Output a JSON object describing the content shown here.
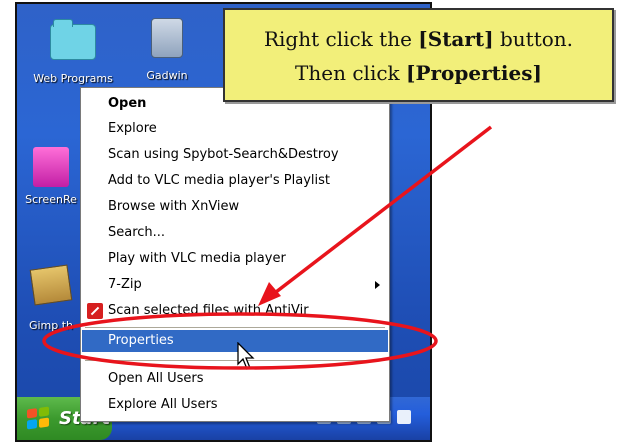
{
  "desktop": {
    "icons": [
      {
        "label": "Web Programs",
        "icon": "folder-icon"
      },
      {
        "label": "Gadwin",
        "icon": "camera-icon"
      },
      {
        "label": "ScreenRe",
        "icon": "pink-folder-icon"
      },
      {
        "label": "Gimp th",
        "icon": "package-icon"
      }
    ]
  },
  "callout": {
    "line1_prefix": "Right click the ",
    "line1_bold": "[Start]",
    "line1_suffix": " button.",
    "line2_prefix": "Then click ",
    "line2_bold": "[Properties]"
  },
  "context_menu": {
    "items": [
      {
        "label": "Open",
        "bold": true
      },
      {
        "label": "Explore"
      },
      {
        "label": "Scan using Spybot-Search&Destroy"
      },
      {
        "label": "Add to VLC media player's Playlist"
      },
      {
        "label": "Browse with XnView"
      },
      {
        "label": "Search..."
      },
      {
        "label": "Play with VLC media player"
      },
      {
        "label": "7-Zip",
        "submenu": true
      },
      {
        "label": "Scan selected files with AntiVir",
        "icon": "antivir-icon"
      },
      {
        "label": "Properties",
        "selected": true
      },
      {
        "label": "Open All Users"
      },
      {
        "label": "Explore All Users"
      }
    ]
  },
  "taskbar": {
    "start_label": "Start"
  },
  "colors": {
    "selection": "#316ac5",
    "callout_bg": "#f2ef7a",
    "annotation_red": "#e8141c",
    "start_green": "#3c9a2e"
  }
}
